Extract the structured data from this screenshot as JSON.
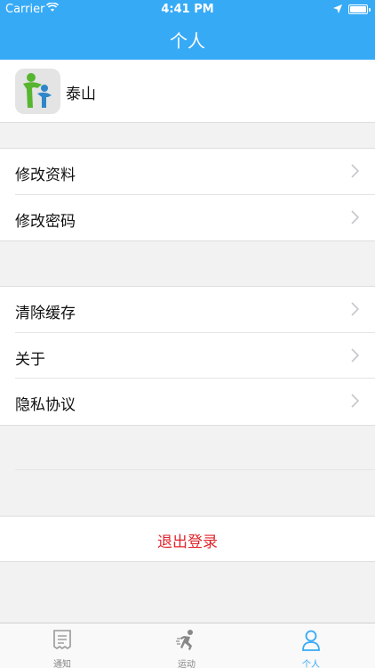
{
  "status_bar": {
    "carrier": "Carrier",
    "time": "4:41 PM"
  },
  "nav": {
    "title": "个人"
  },
  "profile": {
    "name": "泰山",
    "avatar_icon": "family-logo-icon"
  },
  "groups": [
    {
      "items": [
        {
          "label": "修改资料"
        },
        {
          "label": "修改密码"
        }
      ]
    },
    {
      "items": [
        {
          "label": "清除缓存"
        },
        {
          "label": "关于"
        },
        {
          "label": "隐私协议"
        }
      ]
    }
  ],
  "logout": {
    "label": "退出登录"
  },
  "tabbar": {
    "tabs": [
      {
        "label": "通知",
        "icon": "notice-icon",
        "active": false
      },
      {
        "label": "运动",
        "icon": "runner-icon",
        "active": false
      },
      {
        "label": "个人",
        "icon": "person-icon",
        "active": true
      }
    ]
  },
  "colors": {
    "accent": "#37aaf6",
    "logout_red": "#e0242b",
    "background": "#f2f2f2"
  }
}
